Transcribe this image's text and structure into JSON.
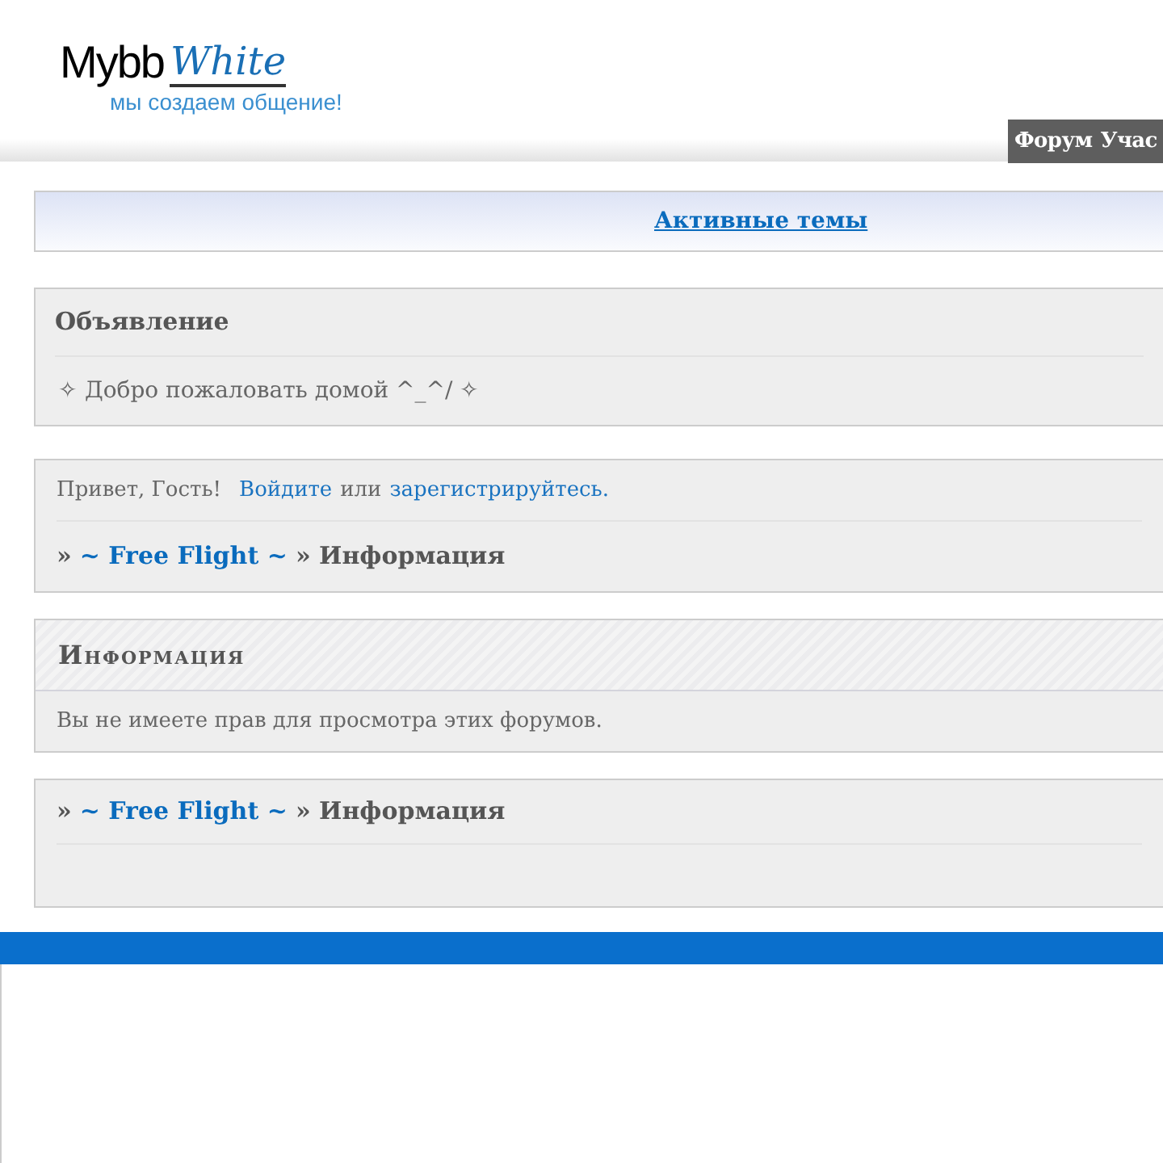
{
  "logo": {
    "word": "Mybb",
    "script": "White",
    "tagline": "мы создаем общение!"
  },
  "nav": [
    "Форум",
    "Учас"
  ],
  "active_topics": {
    "label": "Активные темы"
  },
  "announcement": {
    "title": "Объявление",
    "text": "✧ Добро пожаловать домой ^_^/ ✧"
  },
  "welcome": {
    "greeting": "Привет, Гость!",
    "login": "Войдите",
    "or": "или",
    "register": "зарегистрируйтесь."
  },
  "breadcrumbs": [
    {
      "parts": [
        "»",
        "~ Free Flight ~",
        "» Информация"
      ]
    },
    {
      "parts": [
        "»",
        "~ Free Flight ~",
        "» Информация"
      ]
    }
  ],
  "info": {
    "title": "Информация",
    "text": "Вы не имеете прав для просмотра этих форумов."
  }
}
